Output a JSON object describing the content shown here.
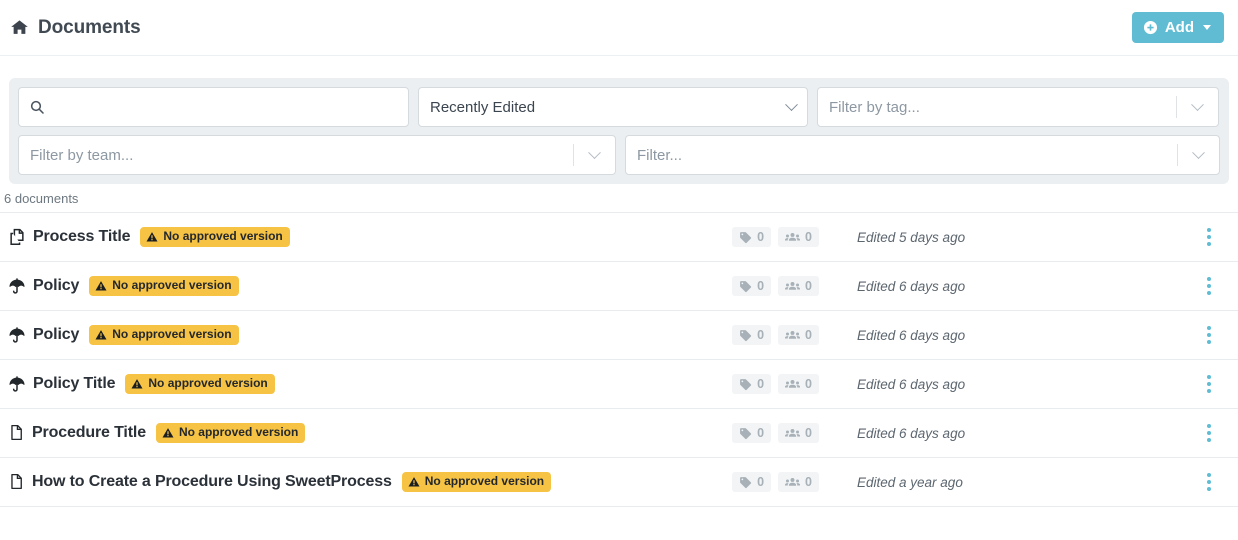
{
  "header": {
    "title": "Documents",
    "home_icon": "home-icon",
    "add_button": {
      "label": "Add",
      "icon": "plus-circle-icon",
      "caret": "caret-down-icon",
      "color": "#5fbcd3"
    }
  },
  "filters": {
    "search": {
      "value": "",
      "placeholder": "",
      "icon": "search-icon"
    },
    "sort": {
      "value": "Recently Edited",
      "icon": "chevron-down-icon"
    },
    "tag": {
      "placeholder": "Filter by tag...",
      "icon": "chevron-down-icon"
    },
    "team": {
      "placeholder": "Filter by team...",
      "icon": "chevron-down-icon"
    },
    "generic": {
      "placeholder": "Filter...",
      "icon": "chevron-down-icon"
    }
  },
  "list": {
    "count_label": "6 documents",
    "badge_text": "No approved version",
    "badge_color": "#f6c344",
    "rows": [
      {
        "title": "Process Title",
        "type_icon": "process-copy-icon",
        "badge": "No approved version",
        "tags": "0",
        "teams": "0",
        "edited": "Edited 5 days ago"
      },
      {
        "title": "Policy",
        "type_icon": "umbrella-icon",
        "badge": "No approved version",
        "tags": "0",
        "teams": "0",
        "edited": "Edited 6 days ago"
      },
      {
        "title": "Policy",
        "type_icon": "umbrella-icon",
        "badge": "No approved version",
        "tags": "0",
        "teams": "0",
        "edited": "Edited 6 days ago"
      },
      {
        "title": "Policy Title",
        "type_icon": "umbrella-icon",
        "badge": "No approved version",
        "tags": "0",
        "teams": "0",
        "edited": "Edited 6 days ago"
      },
      {
        "title": "Procedure Title",
        "type_icon": "file-icon",
        "badge": "No approved version",
        "tags": "0",
        "teams": "0",
        "edited": "Edited 6 days ago"
      },
      {
        "title": "How to Create a Procedure Using SweetProcess",
        "type_icon": "file-icon",
        "badge": "No approved version",
        "tags": "0",
        "teams": "0",
        "edited": "Edited a year ago"
      }
    ]
  }
}
